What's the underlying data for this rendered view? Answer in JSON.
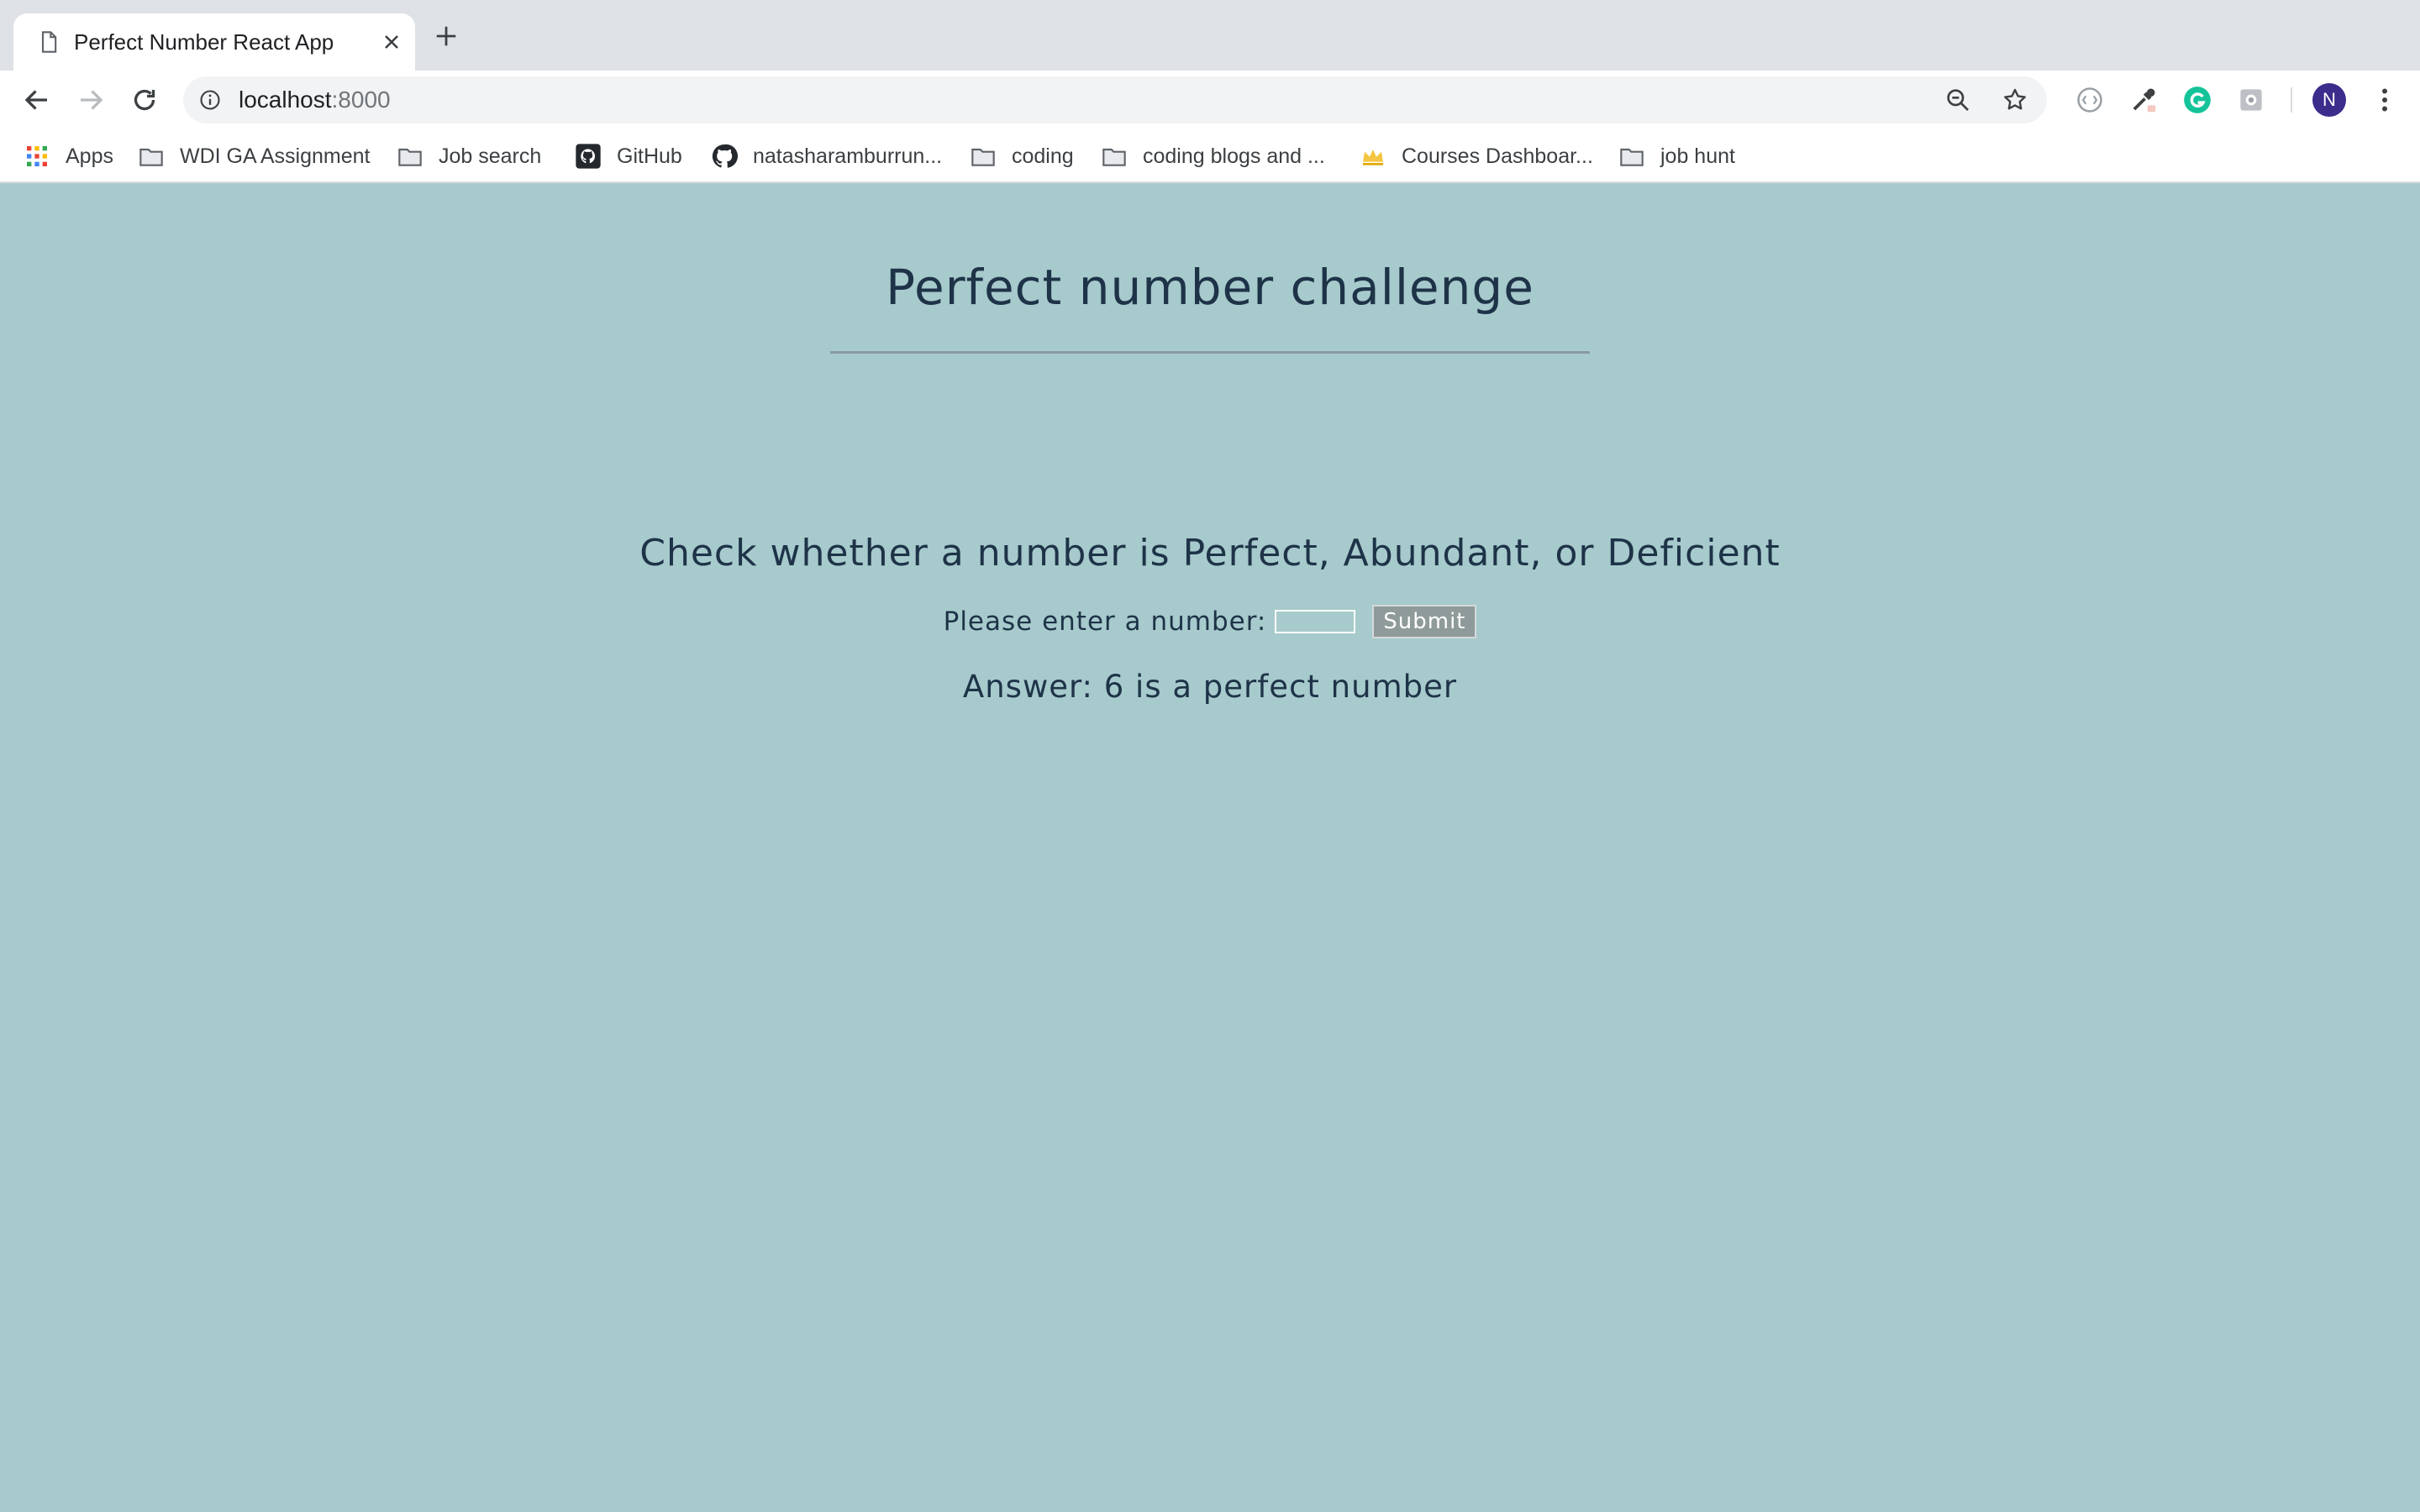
{
  "browser": {
    "tab": {
      "title": "Perfect Number React App"
    },
    "address_bar": {
      "host": "localhost",
      "port": ":8000"
    },
    "profile_initial": "N",
    "bookmarks": [
      {
        "label": "Apps",
        "icon": "apps-grid-icon"
      },
      {
        "label": "WDI GA Assignment",
        "icon": "folder-icon"
      },
      {
        "label": "Job search",
        "icon": "folder-icon"
      },
      {
        "label": "GitHub",
        "icon": "github-icon"
      },
      {
        "label": "natasharamburrun...",
        "icon": "github-icon"
      },
      {
        "label": "coding",
        "icon": "folder-icon"
      },
      {
        "label": "coding blogs and ...",
        "icon": "folder-icon"
      },
      {
        "label": "Courses Dashboar...",
        "icon": "crown-icon"
      },
      {
        "label": "job hunt",
        "icon": "folder-icon"
      }
    ]
  },
  "page": {
    "title": "Perfect number challenge",
    "subtitle": "Check whether a number is Perfect, Abundant, or Deficient",
    "form": {
      "label": "Please enter a number:",
      "input_value": "",
      "submit_label": "Submit"
    },
    "answer": "Answer: 6 is a perfect number"
  },
  "colors": {
    "page_background": "#a7cacc",
    "text": "#1e3348",
    "submit_background": "#8f9a9a",
    "avatar": "#3c2c8c"
  }
}
